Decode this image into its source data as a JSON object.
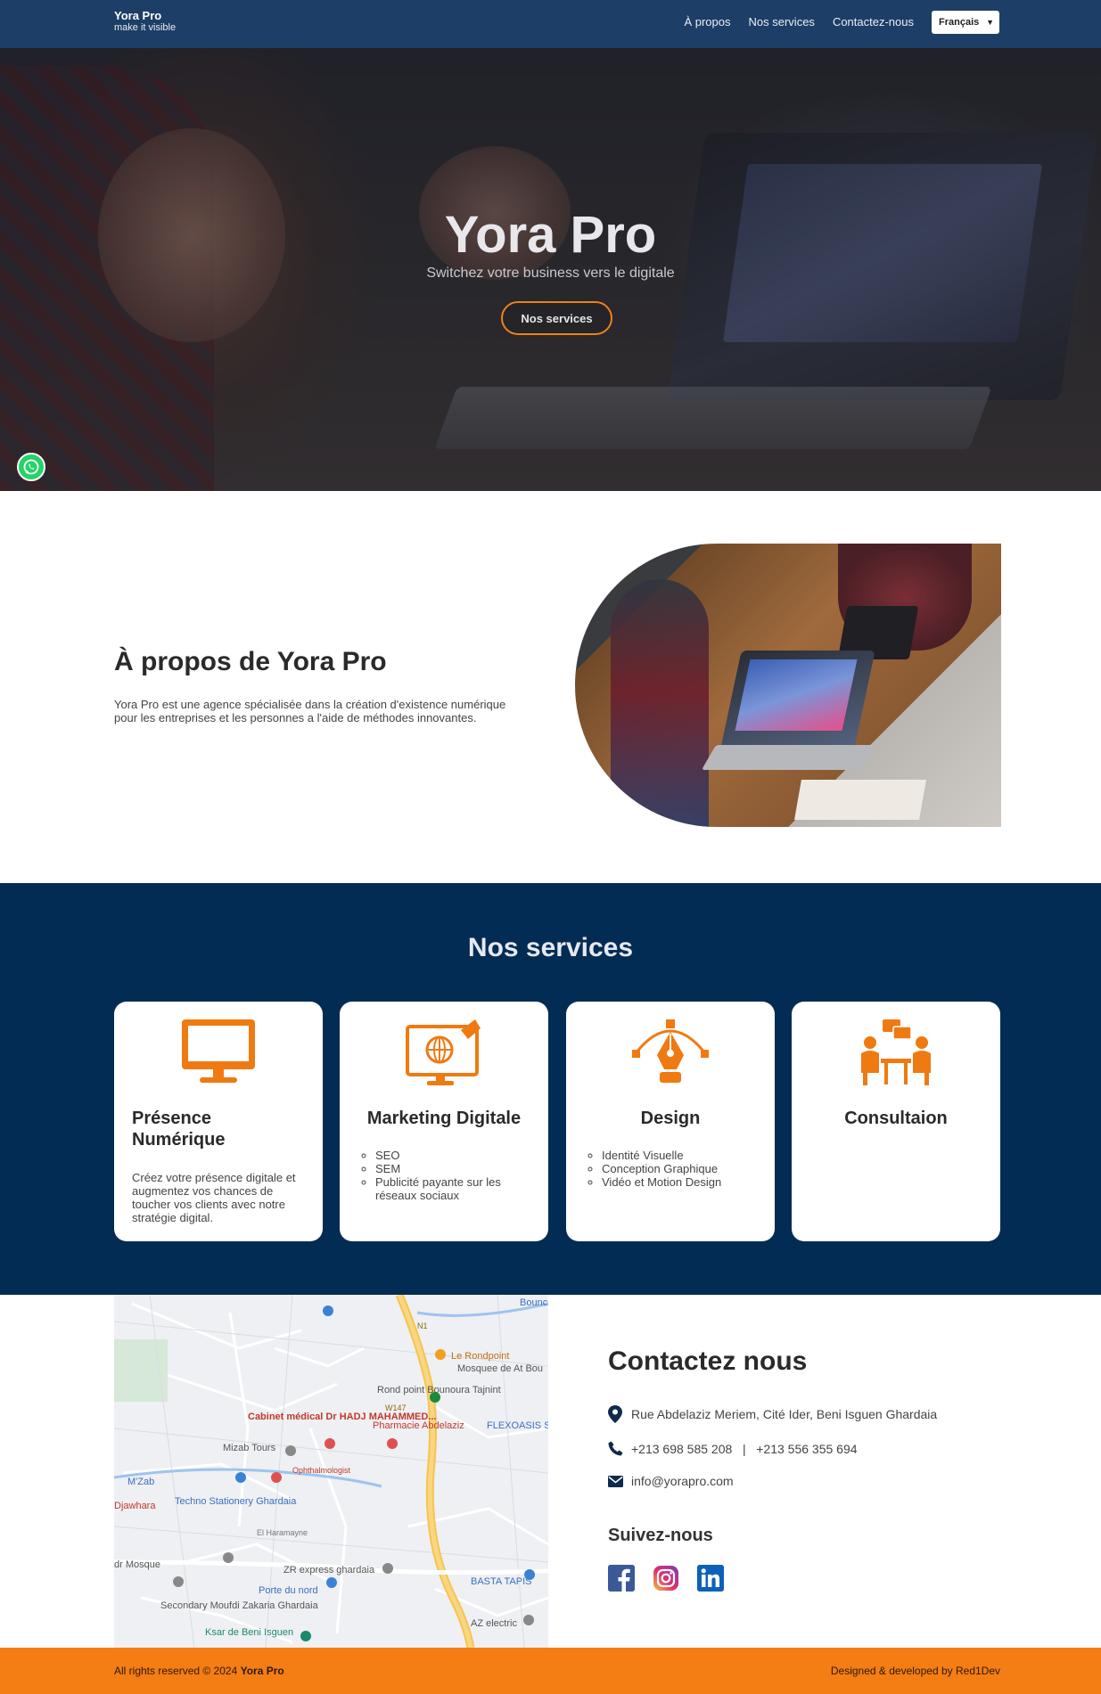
{
  "nav": {
    "brand_title": "Yora Pro",
    "brand_subtitle": "make it visible",
    "links": [
      "À propos",
      "Nos services",
      "Contactez-nous"
    ],
    "language": "Français"
  },
  "hero": {
    "title": "Yora Pro",
    "subtitle": "Switchez votre business vers le digitale",
    "cta": "Nos services"
  },
  "about": {
    "title": "À propos de Yora Pro",
    "text": "Yora Pro est une agence spécialisée dans la création d'existence numérique pour les entreprises et les personnes a l'aide de méthodes innovantes."
  },
  "services": {
    "title": "Nos services",
    "cards": [
      {
        "icon": "monitor-icon",
        "title": "Présence Numérique",
        "text": "Créez votre présence digitale et augmentez vos chances de toucher vos clients avec notre stratégie digital."
      },
      {
        "icon": "digital-marketing-icon",
        "title": "Marketing Digitale",
        "items": [
          "SEO",
          "SEM",
          "Publicité payante sur les réseaux sociaux"
        ]
      },
      {
        "icon": "pen-tool-icon",
        "title": "Design",
        "items": [
          "Identité Visuelle",
          "Conception Graphique",
          "Vidéo et Motion Design"
        ]
      },
      {
        "icon": "consultation-icon",
        "title": "Consultaion"
      }
    ]
  },
  "map": {
    "labels": [
      "Le Rondpoint",
      "Mosquee de At Bou",
      "Rond point Bounoura Tajnint",
      "Cabinet médical Dr HADJ MAHAMMED...",
      "Pharmacie Abdelaziz",
      "FLEXOASIS Shopping mall",
      "Mizab Tours",
      "M'Zab",
      "Techno Stationery Ghardaia",
      "Djawhara",
      "ZR express ghardaia",
      "Porte du nord",
      "BASTA TAPIS",
      "Secondary Moufdi Zakaria Ghardaia",
      "AZ electric",
      "Ksar de Beni Isguen",
      "dr Mosque",
      "W147",
      "N1",
      "Bounc",
      "El Haramayne",
      "Ophthalmologist"
    ]
  },
  "contact": {
    "title": "Contactez nous",
    "address": "Rue Abdelaziz Meriem, Cité Ider, Beni Isguen Ghardaia",
    "phone": "+213 698 585 208   |   +213 556 355 694",
    "email": "info@yorapro.com",
    "follow_title": "Suivez-nous",
    "socials": [
      "facebook-icon",
      "instagram-icon",
      "linkedin-icon"
    ]
  },
  "footer": {
    "rights": "All rights reserved © 2024 ",
    "brand": "Yora Pro",
    "credit": "Designed & developed by Red1Dev"
  },
  "colors": {
    "nav": "#1d3e66",
    "services_bg": "#032c55",
    "accent": "#f47d14",
    "icon_orange": "#ef7a12"
  }
}
